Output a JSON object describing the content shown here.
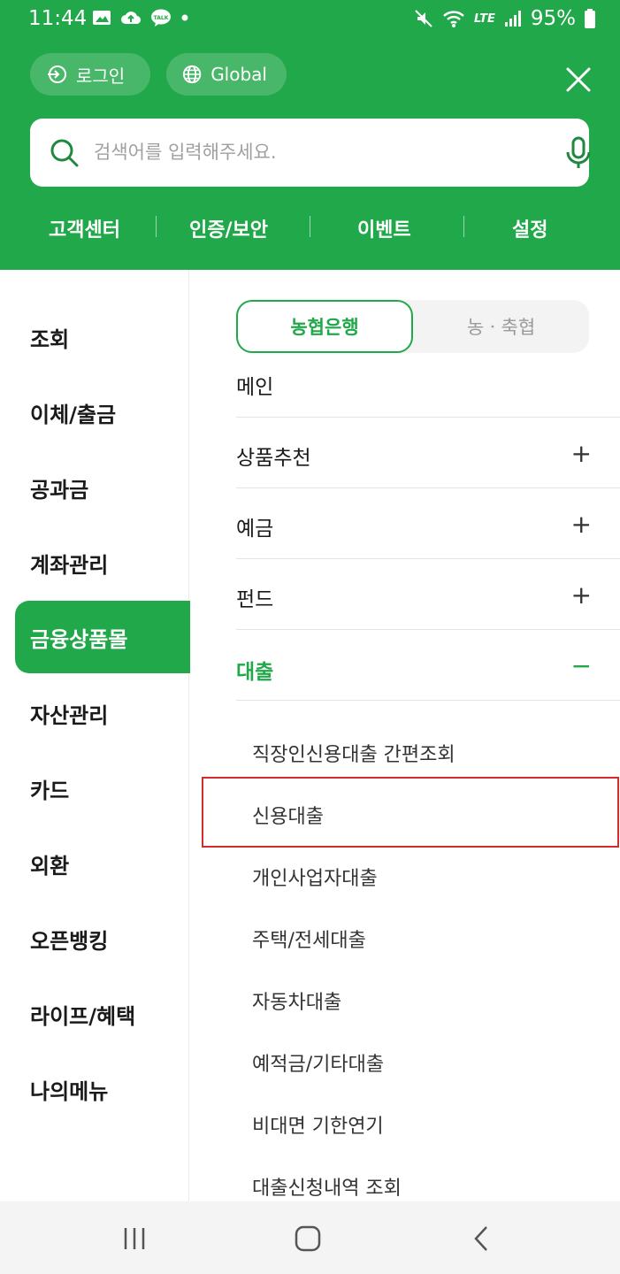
{
  "status": {
    "time": "11:44",
    "battery": "95%",
    "network": "LTE"
  },
  "header": {
    "login_label": "로그인",
    "global_label": "Global",
    "search_placeholder": "검색어를 입력해주세요.",
    "quicklinks": [
      "고객센터",
      "인증/보안",
      "이벤트",
      "설정"
    ],
    "accent_color": "#21a84a"
  },
  "sidebar": {
    "items": [
      {
        "label": "조회"
      },
      {
        "label": "이체/출금"
      },
      {
        "label": "공과금"
      },
      {
        "label": "계좌관리"
      },
      {
        "label": "금융상품몰",
        "active": true
      },
      {
        "label": "자산관리"
      },
      {
        "label": "카드"
      },
      {
        "label": "외환"
      },
      {
        "label": "오픈뱅킹"
      },
      {
        "label": "라이프/혜택"
      },
      {
        "label": "나의메뉴"
      }
    ]
  },
  "panel": {
    "segment": {
      "selected": "농협은행",
      "other": "농ㆍ축협"
    },
    "rows": [
      {
        "label": "메인",
        "expandable": false
      },
      {
        "label": "상품추천",
        "expandable": true,
        "sign": "+"
      },
      {
        "label": "예금",
        "expandable": true,
        "sign": "+"
      },
      {
        "label": "펀드",
        "expandable": true,
        "sign": "+"
      },
      {
        "label": "대출",
        "expandable": true,
        "sign": "−",
        "expanded": true
      }
    ],
    "subitems": [
      "직장인신용대출 간편조회",
      "신용대출",
      "개인사업자대출",
      "주택/전세대출",
      "자동차대출",
      "예적금/기타대출",
      "비대면 기한연기",
      "대출신청내역 조회"
    ],
    "highlight_color": "#d12b2b"
  }
}
